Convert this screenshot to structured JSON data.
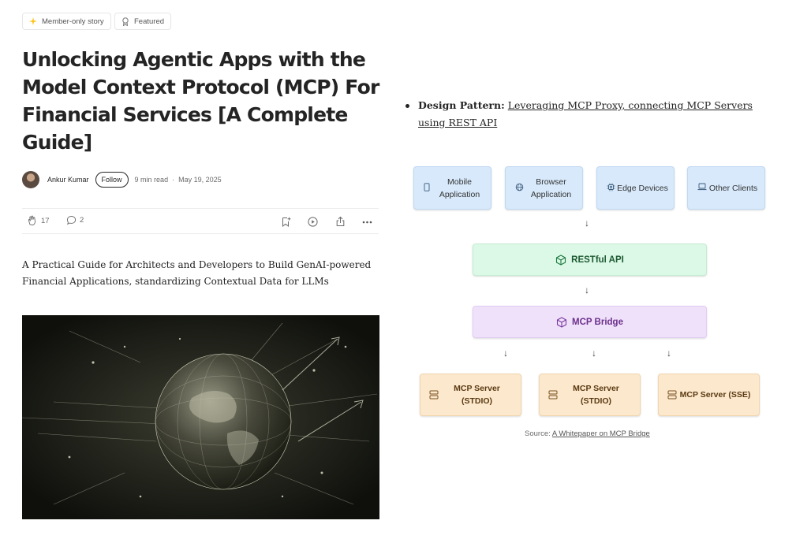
{
  "badges": {
    "member": "Member-only story",
    "featured": "Featured"
  },
  "article": {
    "title": "Unlocking Agentic Apps with the Model Context Protocol (MCP) For Financial Services [A Complete Guide]",
    "subtitle": "A Practical Guide for Architects and Developers to Build GenAI-powered Financial Applications, standardizing Contextual Data for LLMs"
  },
  "byline": {
    "author": "Ankur Kumar",
    "follow": "Follow",
    "read_time": "9 min read",
    "separator": "·",
    "date": "May 19, 2025"
  },
  "actions": {
    "claps": "17",
    "comments": "2"
  },
  "bullet": {
    "label": "Design Pattern:",
    "link_text": "Leveraging MCP Proxy, connecting MCP Servers using REST API"
  },
  "diagram": {
    "clients": [
      {
        "label": "Mobile Application"
      },
      {
        "label": "Browser Application"
      },
      {
        "label": "Edge Devices"
      },
      {
        "label": "Other Clients"
      }
    ],
    "api": "RESTful API",
    "bridge": "MCP Bridge",
    "servers": [
      {
        "label": "MCP Server (STDIO)"
      },
      {
        "label": "MCP Server (STDIO)"
      },
      {
        "label": "MCP Server (SSE)"
      }
    ],
    "arrow": "↓",
    "source_label": "Source:",
    "source_link": "A Whitepaper on MCP Bridge"
  },
  "colors": {
    "client": "#d7e9fb",
    "api": "#dcf8e6",
    "bridge": "#f0e1fb",
    "server": "#fbe8cd",
    "star": "#ffc017"
  }
}
